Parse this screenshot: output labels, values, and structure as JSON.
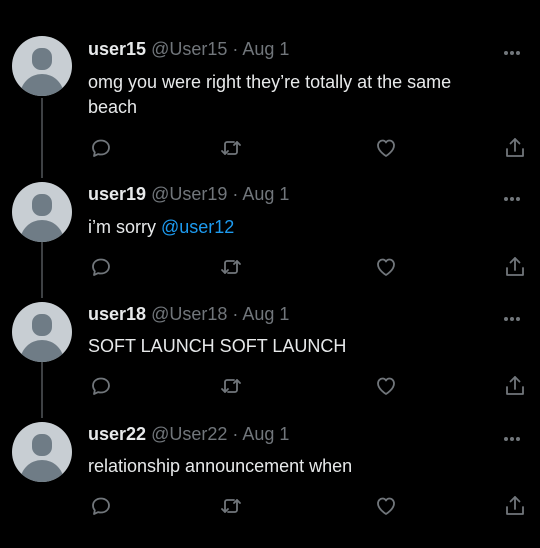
{
  "tweets": [
    {
      "name": "user15",
      "handle": "@User15",
      "date": "Aug 1",
      "text_plain": "omg you were right they’re totally at the same beach",
      "text_mention": ""
    },
    {
      "name": "user19",
      "handle": "@User19",
      "date": "Aug 1",
      "text_plain": "i’m sorry ",
      "text_mention": "@user12"
    },
    {
      "name": "user18",
      "handle": "@User18",
      "date": "Aug 1",
      "text_plain": "SOFT LAUNCH SOFT LAUNCH",
      "text_mention": ""
    },
    {
      "name": "user22",
      "handle": "@User22",
      "date": "Aug 1",
      "text_plain": "relationship announcement when",
      "text_mention": ""
    }
  ],
  "separator": " · ",
  "colors": {
    "background": "#000000",
    "text": "#e7e9ea",
    "muted": "#71767b",
    "mention": "#1d9bf0",
    "thread_line": "#3e4144"
  },
  "icons": [
    "more-icon",
    "reply-icon",
    "retweet-icon",
    "like-icon",
    "share-icon"
  ]
}
